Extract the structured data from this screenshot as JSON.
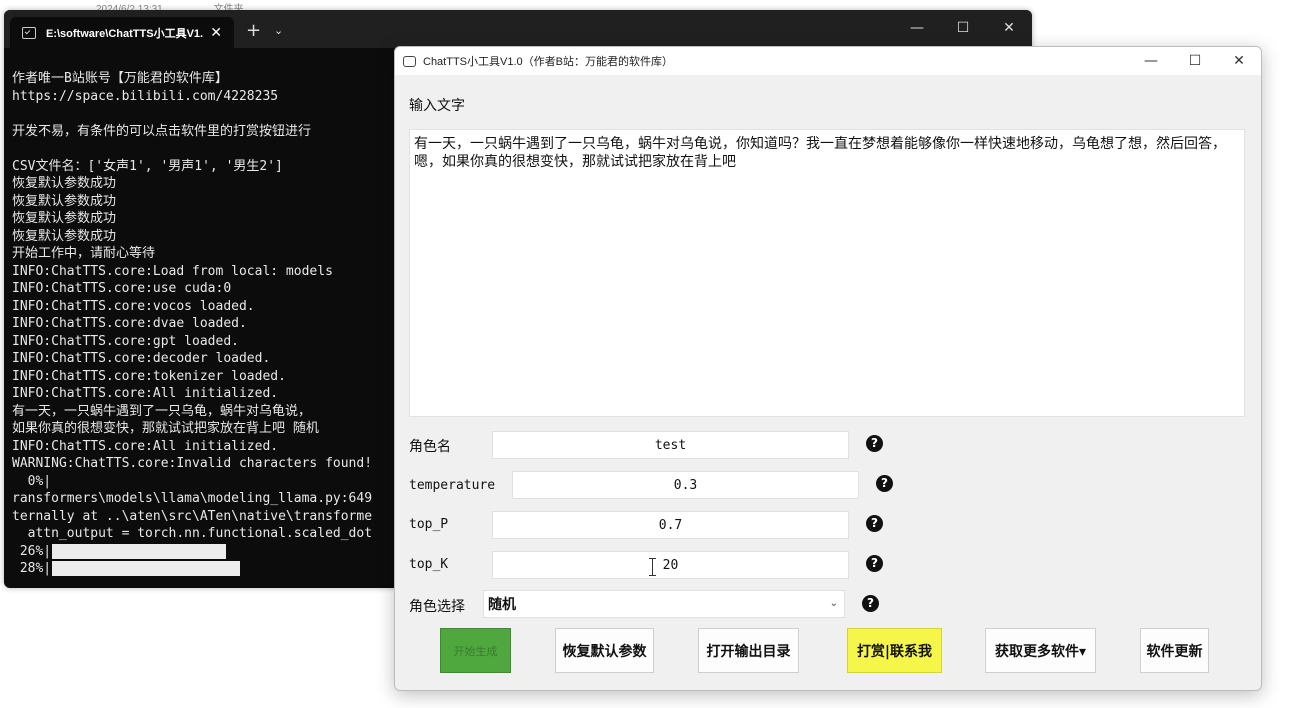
{
  "desktop": {
    "date": "2024/6/2 13:31",
    "type": "文件夹"
  },
  "terminal": {
    "tab_title": "E:\\software\\ChatTTS小工具V1.",
    "tab_close": "✕",
    "new_tab": "+",
    "dropdown": "⌄",
    "controls": {
      "minimize": "—",
      "maximize": "☐",
      "close": "✕"
    },
    "lines": [
      "作者唯一B站账号【万能君的软件库】",
      "https://space.bilibili.com/4228235",
      "",
      "开发不易，有条件的可以点击软件里的打赏按钮进行",
      "",
      "CSV文件名：['女声1', '男声1', '男生2']",
      "恢复默认参数成功",
      "恢复默认参数成功",
      "恢复默认参数成功",
      "恢复默认参数成功",
      "开始工作中，请耐心等待",
      "INFO:ChatTTS.core:Load from local: models",
      "INFO:ChatTTS.core:use cuda:0",
      "INFO:ChatTTS.core:vocos loaded.",
      "INFO:ChatTTS.core:dvae loaded.",
      "INFO:ChatTTS.core:gpt loaded.",
      "INFO:ChatTTS.core:decoder loaded.",
      "INFO:ChatTTS.core:tokenizer loaded.",
      "INFO:ChatTTS.core:All initialized.",
      "有一天，一只蜗牛遇到了一只乌龟，蜗牛对乌龟说，",
      "如果你真的很想变快，那就试试把家放在背上吧 随机",
      "INFO:ChatTTS.core:All initialized.",
      "WARNING:ChatTTS.core:Invalid characters found!",
      "  0%|",
      "ransformers\\models\\llama\\modeling_llama.py:649",
      "ternally at ..\\aten\\src\\ATen\\native\\transforme",
      "  attn_output = torch.nn.functional.scaled_dot"
    ],
    "progress": [
      {
        "label": " 26%|",
        "fraction": 0.26
      },
      {
        "label": " 28%|",
        "fraction": 0.28
      }
    ]
  },
  "app": {
    "title": "ChatTTS小工具V1.0（作者B站：万能君的软件库）",
    "controls": {
      "minimize": "—",
      "maximize": "☐",
      "close": "✕"
    },
    "input_label": "输入文字",
    "input_text": "有一天，一只蜗牛遇到了一只乌龟，蜗牛对乌龟说，你知道吗？我一直在梦想着能够像你一样快速地移动，乌龟想了想，然后回答，嗯，如果你真的很想变快，那就试试把家放在背上吧",
    "role_name_label": "角色名",
    "role_name_value": "test",
    "temperature_label": "temperature",
    "temperature_value": "0.3",
    "top_p_label": "top_P",
    "top_p_value": "0.7",
    "top_k_label": "top_K",
    "top_k_value": "20",
    "role_select_label": "角色选择",
    "role_select_value": "随机",
    "help_glyph": "?",
    "buttons": {
      "start": "开始生成",
      "restore": "恢复默认参数",
      "open_output": "打开输出目录",
      "donate": "打赏|联系我",
      "more": "获取更多软件▾",
      "update": "软件更新"
    }
  },
  "colors": {
    "terminal_bg": "#0c0c0c",
    "start_button": "#4fa83d",
    "donate_button": "#f6f64a"
  }
}
